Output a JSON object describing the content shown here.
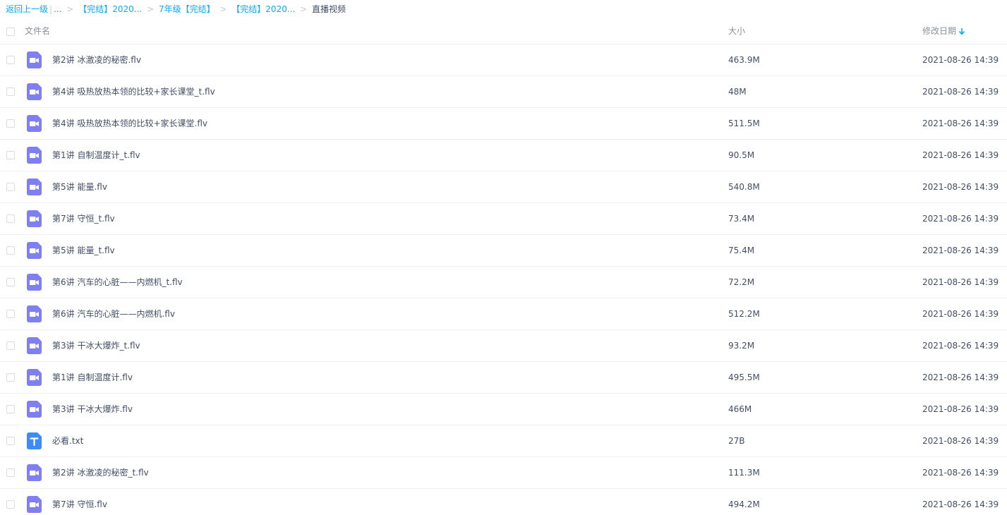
{
  "breadcrumb": {
    "back": "返回上一级",
    "divider": "|",
    "ellipsis": "...",
    "separator": ">",
    "items": [
      "【完结】2020...",
      "7年级【完结】",
      "【完结】2020..."
    ],
    "current": "直播视频"
  },
  "header": {
    "name": "文件名",
    "size": "大小",
    "date": "修改日期"
  },
  "colors": {
    "link": "#09AAFF",
    "video_icon": "#7F7FF2",
    "text_icon": "#3E8CF3",
    "text": "#424E67"
  },
  "files": [
    {
      "name": "第2讲 冰激凌的秘密.flv",
      "size": "463.9M",
      "date": "2021-08-26 14:39",
      "icon": "video-file-icon"
    },
    {
      "name": "第4讲 吸热放热本领的比较+家长课堂_t.flv",
      "size": "48M",
      "date": "2021-08-26 14:39",
      "icon": "video-file-icon"
    },
    {
      "name": "第4讲 吸热放热本领的比较+家长课堂.flv",
      "size": "511.5M",
      "date": "2021-08-26 14:39",
      "icon": "video-file-icon"
    },
    {
      "name": "第1讲 自制温度计_t.flv",
      "size": "90.5M",
      "date": "2021-08-26 14:39",
      "icon": "video-file-icon"
    },
    {
      "name": "第5讲 能量.flv",
      "size": "540.8M",
      "date": "2021-08-26 14:39",
      "icon": "video-file-icon"
    },
    {
      "name": "第7讲 守恒_t.flv",
      "size": "73.4M",
      "date": "2021-08-26 14:39",
      "icon": "video-file-icon"
    },
    {
      "name": "第5讲 能量_t.flv",
      "size": "75.4M",
      "date": "2021-08-26 14:39",
      "icon": "video-file-icon"
    },
    {
      "name": "第6讲 汽车的心脏——内燃机_t.flv",
      "size": "72.2M",
      "date": "2021-08-26 14:39",
      "icon": "video-file-icon"
    },
    {
      "name": "第6讲 汽车的心脏——内燃机.flv",
      "size": "512.2M",
      "date": "2021-08-26 14:39",
      "icon": "video-file-icon"
    },
    {
      "name": "第3讲 干冰大爆炸_t.flv",
      "size": "93.2M",
      "date": "2021-08-26 14:39",
      "icon": "video-file-icon"
    },
    {
      "name": "第1讲 自制温度计.flv",
      "size": "495.5M",
      "date": "2021-08-26 14:39",
      "icon": "video-file-icon"
    },
    {
      "name": "第3讲 干冰大爆炸.flv",
      "size": "466M",
      "date": "2021-08-26 14:39",
      "icon": "video-file-icon"
    },
    {
      "name": "必看.txt",
      "size": "27B",
      "date": "2021-08-26 14:39",
      "icon": "text-file-icon"
    },
    {
      "name": "第2讲 冰激凌的秘密_t.flv",
      "size": "111.3M",
      "date": "2021-08-26 14:39",
      "icon": "video-file-icon"
    },
    {
      "name": "第7讲 守恒.flv",
      "size": "494.2M",
      "date": "2021-08-26 14:39",
      "icon": "video-file-icon"
    }
  ]
}
